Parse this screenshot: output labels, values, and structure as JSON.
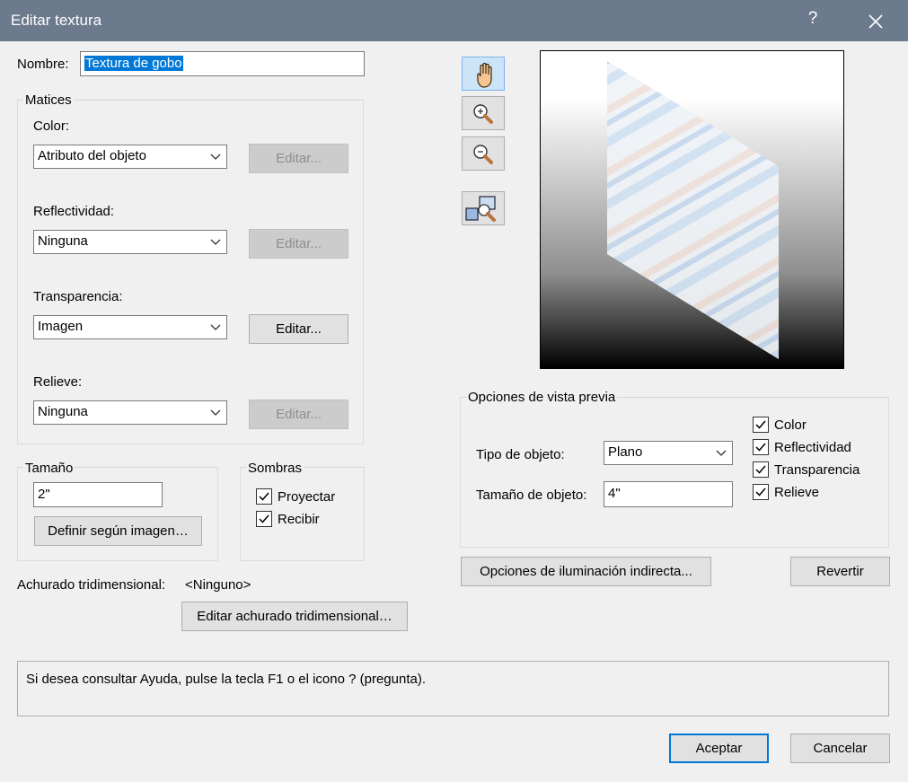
{
  "window": {
    "title": "Editar textura",
    "help_glyph": "?",
    "close_glyph": "close"
  },
  "name": {
    "label": "Nombre:",
    "value": "Textura de gobo"
  },
  "matices": {
    "label": "Matices",
    "rows": [
      {
        "label": "Color:",
        "value": "Atributo del objeto",
        "button": "Editar...",
        "enabled": false
      },
      {
        "label": "Reflectividad:",
        "value": "Ninguna",
        "button": "Editar...",
        "enabled": false
      },
      {
        "label": "Transparencia:",
        "value": "Imagen",
        "button": "Editar...",
        "enabled": true
      },
      {
        "label": "Relieve:",
        "value": "Ninguna",
        "button": "Editar...",
        "enabled": false
      }
    ]
  },
  "tamano": {
    "label": "Tamaño",
    "value": "2\"",
    "button": "Definir según imagen…"
  },
  "sombras": {
    "label": "Sombras",
    "proyectar": "Proyectar",
    "recibir": "Recibir",
    "proyectar_checked": true,
    "recibir_checked": true
  },
  "achurado": {
    "label": "Achurado tridimensional:",
    "value": "<Ninguno>",
    "button": "Editar achurado tridimensional…"
  },
  "tools": {
    "pan": "hand-icon",
    "zoom_in": "zoom-in-icon",
    "zoom_out": "zoom-out-icon",
    "zoom_fit": "zoom-fit-icon"
  },
  "preview_options": {
    "label": "Opciones de vista previa",
    "tipo_label": "Tipo de objeto:",
    "tipo_value": "Plano",
    "tamano_label": "Tamaño de objeto:",
    "tamano_value": "4\"",
    "checks": [
      {
        "label": "Color",
        "checked": true
      },
      {
        "label": "Reflectividad",
        "checked": true
      },
      {
        "label": "Transparencia",
        "checked": true
      },
      {
        "label": "Relieve",
        "checked": true
      }
    ]
  },
  "buttons": {
    "iluminacion": "Opciones de iluminación indirecta...",
    "revertir": "Revertir",
    "aceptar": "Aceptar",
    "cancelar": "Cancelar"
  },
  "status": "Si desea consultar Ayuda, pulse la tecla F1 o el icono ? (pregunta)."
}
